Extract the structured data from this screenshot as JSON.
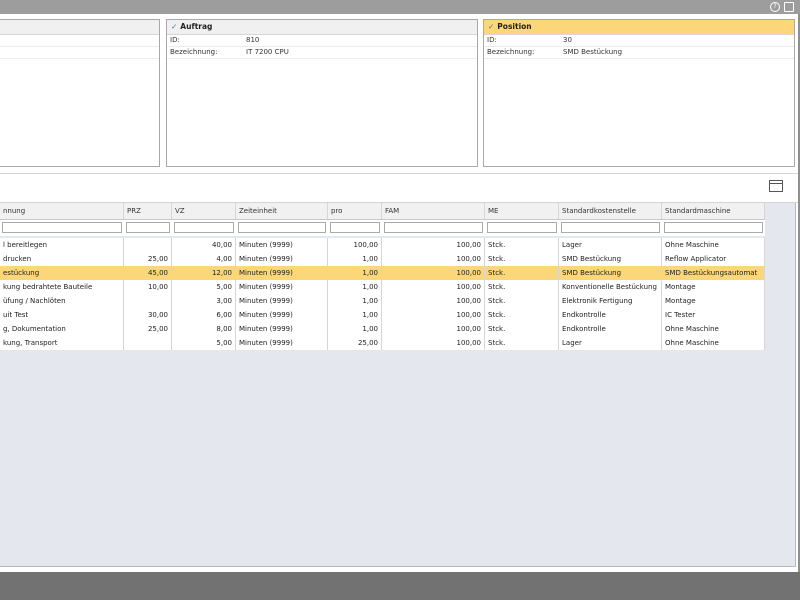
{
  "top_icons": {
    "help": "?",
    "window": "▭"
  },
  "panels": [
    {
      "id": "left",
      "title": "",
      "rows": [
        {
          "key": "",
          "value": ""
        },
        {
          "key": "",
          "value": ""
        }
      ]
    },
    {
      "id": "auftrag",
      "title": "Auftrag",
      "rows": [
        {
          "key": "ID:",
          "value": "810"
        },
        {
          "key": "Bezeichnung:",
          "value": "IT 7200 CPU"
        }
      ]
    },
    {
      "id": "position",
      "title": "Position",
      "rows": [
        {
          "key": "ID:",
          "value": "30"
        },
        {
          "key": "Bezeichnung:",
          "value": "SMD Bestückung"
        }
      ]
    }
  ],
  "grid": {
    "columns": [
      "nnung",
      "PRZ",
      "VZ",
      "Zeiteinheit",
      "pro",
      "FAM",
      "ME",
      "Standardkostenstelle",
      "Standardmaschine"
    ],
    "rows": [
      [
        "l bereitlegen",
        "",
        "40,00",
        "Minuten (9999)",
        "100,00",
        "100,00",
        "Stck.",
        "Lager",
        "Ohne Maschine"
      ],
      [
        "drucken",
        "25,00",
        "4,00",
        "Minuten (9999)",
        "1,00",
        "100,00",
        "Stck.",
        "SMD Bestückung",
        "Reflow Applicator"
      ],
      [
        "estückung",
        "45,00",
        "12,00",
        "Minuten (9999)",
        "1,00",
        "100,00",
        "Stck.",
        "SMD Bestückung",
        "SMD Bestückungsautomat"
      ],
      [
        "kung bedrahtete Bauteile",
        "10,00",
        "5,00",
        "Minuten (9999)",
        "1,00",
        "100,00",
        "Stck.",
        "Konventionelle Bestückung",
        "Montage"
      ],
      [
        "üfung / Nachlöten",
        "",
        "3,00",
        "Minuten (9999)",
        "1,00",
        "100,00",
        "Stck.",
        "Elektronik Fertigung",
        "Montage"
      ],
      [
        "uit Test",
        "30,00",
        "6,00",
        "Minuten (9999)",
        "1,00",
        "100,00",
        "Stck.",
        "Endkontrolle",
        "IC Tester"
      ],
      [
        "g, Dokumentation",
        "25,00",
        "8,00",
        "Minuten (9999)",
        "1,00",
        "100,00",
        "Stck.",
        "Endkontrolle",
        "Ohne Maschine"
      ],
      [
        "kung, Transport",
        "",
        "5,00",
        "Minuten (9999)",
        "25,00",
        "100,00",
        "Stck.",
        "Lager",
        "Ohne Maschine"
      ]
    ],
    "selected_row": 2
  },
  "colors": {
    "selected": "#fbd77a",
    "panel_header": "#f0f0f0",
    "grid_empty": "#e4e8ee"
  }
}
